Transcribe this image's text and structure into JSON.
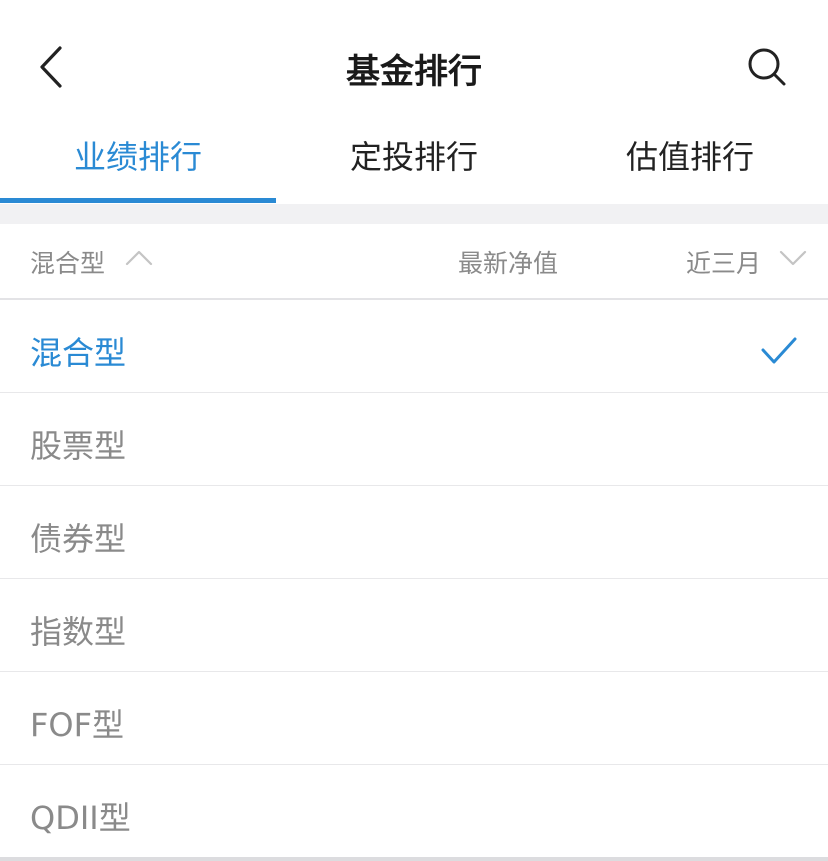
{
  "header": {
    "title": "基金排行",
    "back_icon": "chevron-left-icon",
    "search_icon": "search-icon"
  },
  "tabs": [
    {
      "label": "业绩排行",
      "active": true
    },
    {
      "label": "定投排行",
      "active": false
    },
    {
      "label": "估值排行",
      "active": false
    }
  ],
  "filter_bar": {
    "type_label": "混合型",
    "type_icon": "chevron-up-icon",
    "nav_label": "最新净值",
    "period_label": "近三月",
    "period_icon": "chevron-down-icon"
  },
  "type_options": [
    {
      "label": "混合型",
      "selected": true
    },
    {
      "label": "股票型",
      "selected": false
    },
    {
      "label": "债券型",
      "selected": false
    },
    {
      "label": "指数型",
      "selected": false
    },
    {
      "label": "FOF型",
      "selected": false
    },
    {
      "label": "QDII型",
      "selected": false
    }
  ],
  "colors": {
    "accent": "#2a8ad4",
    "muted_text": "#8a8a8a",
    "divider": "#e8e8ea",
    "section_gap": "#f1f1f3"
  }
}
